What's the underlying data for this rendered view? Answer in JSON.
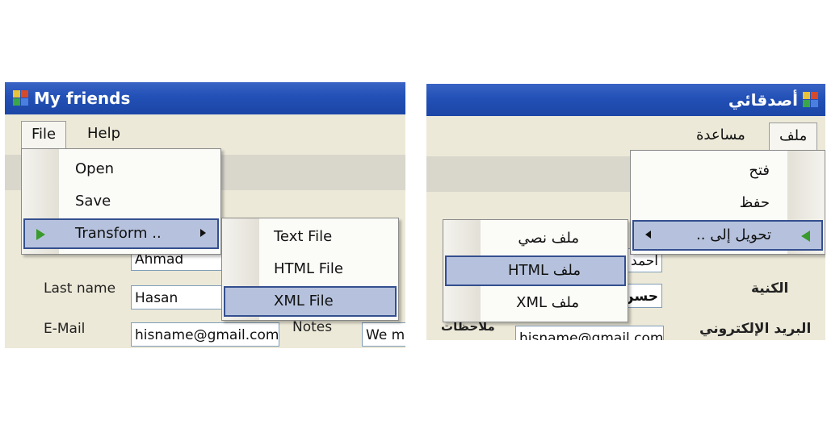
{
  "english_window": {
    "title": "My friends",
    "menu": [
      "File",
      "Help"
    ],
    "file_menu": [
      "Open",
      "Save",
      "Transform .."
    ],
    "transform_submenu": [
      "Text File",
      "HTML File",
      "XML File"
    ],
    "form": {
      "name_value": "Ahmad",
      "last_name_label": "Last name",
      "last_name_value": "Hasan",
      "email_label": "E-Mail",
      "email_value": "hisname@gmail.com",
      "notes_label": "Notes",
      "notes_value": "We m"
    }
  },
  "arabic_window": {
    "title": "أصدقائي",
    "menu": [
      "ملف",
      "مساعدة"
    ],
    "file_menu": [
      "فتح",
      "حفظ",
      "تحويل إلى .."
    ],
    "transform_submenu": [
      "ملف نصي",
      "ملف HTML",
      "ملف XML"
    ],
    "form": {
      "last_name_label": "الكنية",
      "email_label": "البريد الإلكتروني",
      "notes_label": "ملاحظات",
      "name_value": "أحمد",
      "last_name_value": "حسن",
      "email_value": "hisname@gmail.com"
    }
  },
  "colors": {
    "titlebar": "#2250b6",
    "highlight": "#b6c2dd",
    "highlight_border": "#344f8f",
    "arrow_green": "#3a9a2c"
  }
}
